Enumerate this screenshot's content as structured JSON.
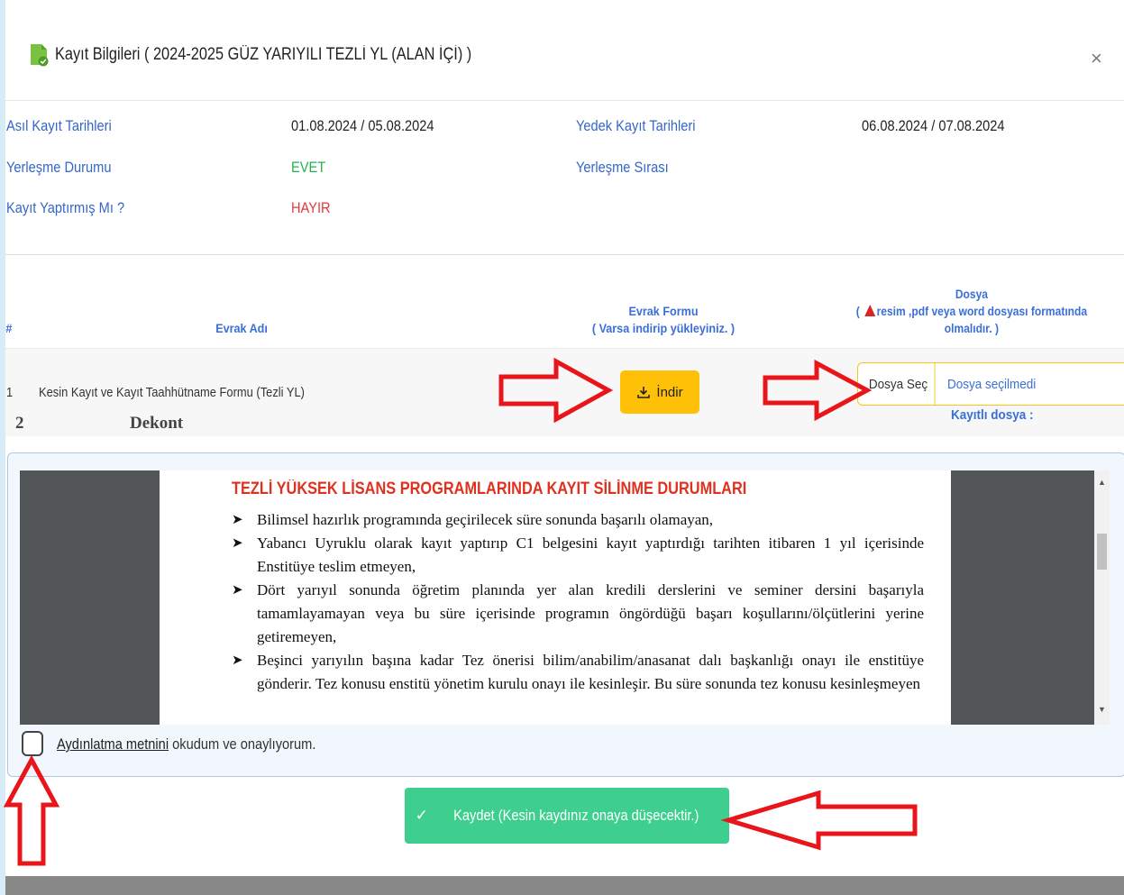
{
  "modal": {
    "title": "Kayıt Bilgileri ( 2024-2025 GÜZ YARIYILI TEZLİ YL (ALAN İÇİ) )",
    "close_label": "×"
  },
  "info": {
    "asil_label": "Asıl Kayıt Tarihleri",
    "asil_value": "01.08.2024 / 05.08.2024",
    "yedek_label": "Yedek Kayıt Tarihleri",
    "yedek_value": "06.08.2024 / 07.08.2024",
    "yerlesme_label": "Yerleşme Durumu",
    "yerlesme_value": "EVET",
    "sira_label": "Yerleşme Sırası",
    "kayit_label": "Kayıt Yaptırmış Mı ?",
    "kayit_value": "HAYIR"
  },
  "table": {
    "col_no": "#",
    "col_name": "Evrak Adı",
    "col_form_line1": "Evrak Formu",
    "col_form_line2": "( Varsa indirip yükleyiniz. )",
    "col_file_line1": "Dosya",
    "col_file_line2_pre": "(",
    "col_file_line2": "resim ,pdf veya word dosyası formatında",
    "col_file_line3": "olmalıdır. )",
    "rows": [
      {
        "no": "1",
        "name": "Kesin Kayıt ve Kayıt Taahhütname Formu (Tezli YL)"
      },
      {
        "no": "2",
        "name": "Dekont"
      }
    ],
    "download_label": "İndir",
    "choose_file_label": "Dosya Seç",
    "no_file_label": "Dosya seçilmedi",
    "registered_file_label": "Kayıtlı dosya :"
  },
  "document": {
    "title": "TEZLİ YÜKSEK LİSANS PROGRAMLARINDA KAYIT SİLİNME DURUMLARI",
    "items": [
      "Bilimsel hazırlık programında geçirilecek süre sonunda başarılı olamayan,",
      "Yabancı Uyruklu olarak kayıt yaptırıp C1 belgesini kayıt yaptırdığı tarihten itibaren 1 yıl içerisinde Enstitüye teslim etmeyen,",
      "Dört yarıyıl sonunda öğretim planında yer alan kredili derslerini ve seminer dersini başarıyla tamamlayamayan veya bu süre içerisinde programın öngördüğü başarı koşullarını/ölçütlerini yerine getiremeyen,",
      "Beşinci yarıyılın başına kadar Tez önerisi bilim/anabilim/anasanat dalı başkanlığı onayı ile enstitüye gönderir. Tez konusu enstitü yönetim kurulu onayı ile kesinleşir. Bu süre sonunda tez konusu kesinleşmeyen"
    ]
  },
  "consent": {
    "link_text": "Aydınlatma metnini",
    "rest_text": " okudum ve onaylıyorum."
  },
  "save_button": {
    "check": "✓",
    "label": "Kaydet (Kesin kaydınız onaya düşecektir.)"
  },
  "colors": {
    "accent_blue": "#3a6fd8",
    "warning_yellow": "#ffc107",
    "success_green": "#3ecf8e",
    "annotation_red": "#e8161b"
  }
}
